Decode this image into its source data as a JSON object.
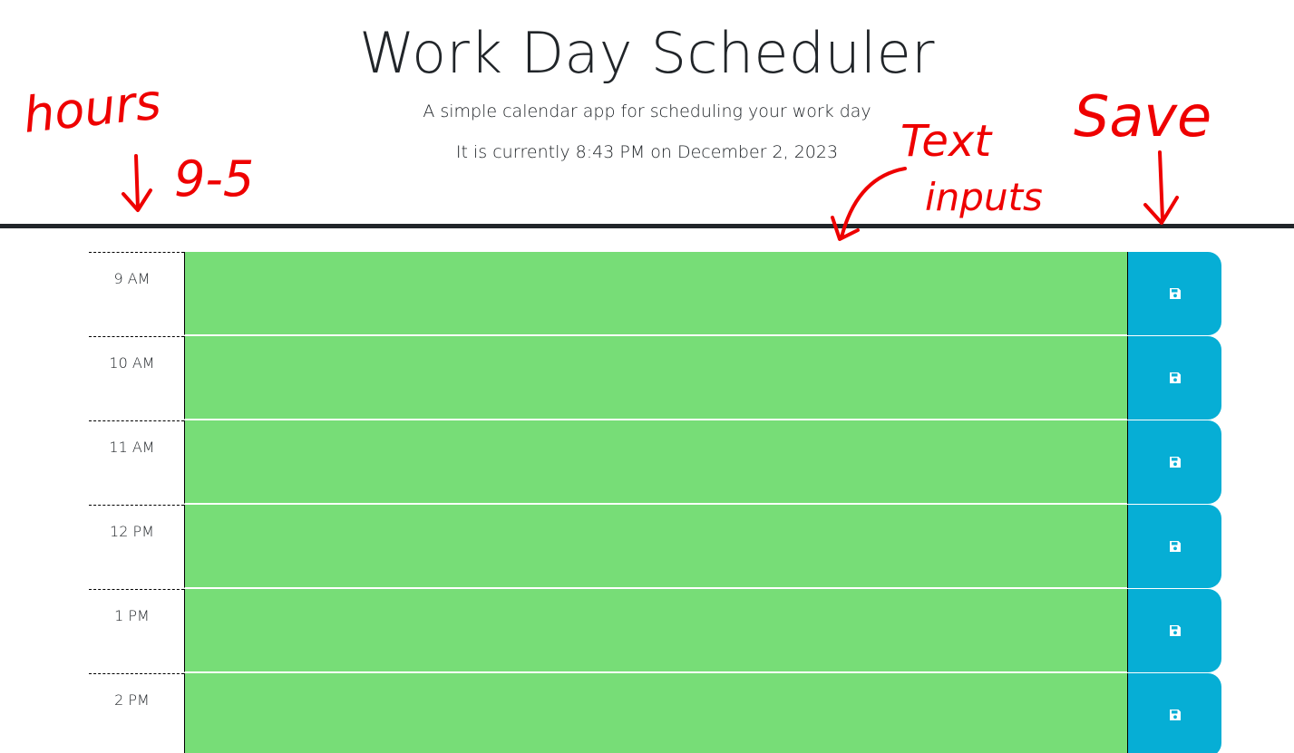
{
  "header": {
    "title": "Work Day Scheduler",
    "subtitle": "A simple calendar app for scheduling your work day",
    "current_day": "It is currently 8:43 PM on December 2, 2023"
  },
  "annotations": {
    "hours": "hours",
    "range": "9-5",
    "text_inputs_line1": "Text",
    "text_inputs_line2": "inputs",
    "save": "Save",
    "color": "#ee0000"
  },
  "schedule": {
    "rows": [
      {
        "hour": "9 AM",
        "text": ""
      },
      {
        "hour": "10 AM",
        "text": ""
      },
      {
        "hour": "11 AM",
        "text": ""
      },
      {
        "hour": "12 PM",
        "text": ""
      },
      {
        "hour": "1 PM",
        "text": ""
      },
      {
        "hour": "2 PM",
        "text": ""
      }
    ],
    "save_icon": "floppy-disk-icon"
  },
  "colors": {
    "future": "#77dd77",
    "save_button": "#06aed5",
    "rule": "#212529"
  }
}
